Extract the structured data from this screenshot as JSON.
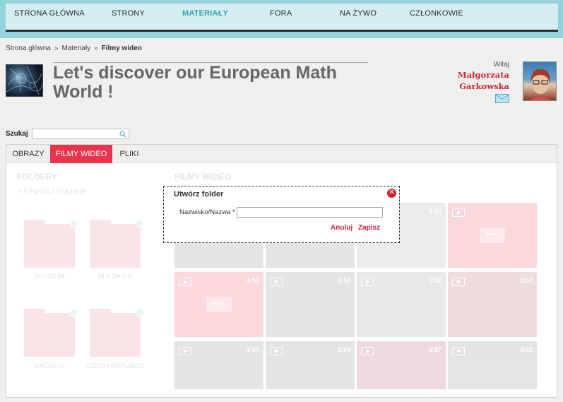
{
  "nav": {
    "items": [
      {
        "label": "STRONA GŁÓWNA",
        "active": false
      },
      {
        "label": "STRONY",
        "active": false
      },
      {
        "label": "MATERIAŁY",
        "active": true
      },
      {
        "label": "FORA",
        "active": false
      },
      {
        "label": "NA ŻYWO",
        "active": false
      },
      {
        "label": "CZŁONKOWIE",
        "active": false
      }
    ]
  },
  "breadcrumb": {
    "items": [
      "Strona główna",
      "Materiały",
      "Filmy wideo"
    ],
    "separator": "»"
  },
  "header": {
    "title": "Let's discover our European Math World !"
  },
  "user": {
    "greeting": "Witaj",
    "first_name": "Małgorzata",
    "last_name": "Garkowska"
  },
  "search": {
    "label": "Szukaj",
    "value": ""
  },
  "tabs": [
    {
      "label": "OBRAZY",
      "active": false
    },
    {
      "label": "FILMY WIDEO",
      "active": true
    },
    {
      "label": "PLIKI",
      "active": false
    }
  ],
  "folders": {
    "title": "FOLDERY",
    "create_label": "+ UTWÓRZ FOLDER",
    "items": [
      "BELGIUM",
      "BULGARIA",
      "CROATIA",
      "CZECH REPUBLIC"
    ]
  },
  "videos": {
    "title": "FILMY WIDEO",
    "durations": [
      "3:50",
      "",
      "",
      "3:52",
      "3:52",
      "3:52",
      "3:52",
      "3:54",
      "3:54",
      "3:57",
      "3:57",
      "3:41"
    ]
  },
  "dialog": {
    "title": "Utwórz folder",
    "field_label": "Nazwisko/Nazwa *",
    "field_value": "",
    "cancel_label": "Anuluj",
    "save_label": "Zapisz"
  },
  "colors": {
    "accent": "#e8344f",
    "nav_bg": "#95d3db",
    "nav_active": "#2aa1c0",
    "user_name": "#c8283a"
  }
}
